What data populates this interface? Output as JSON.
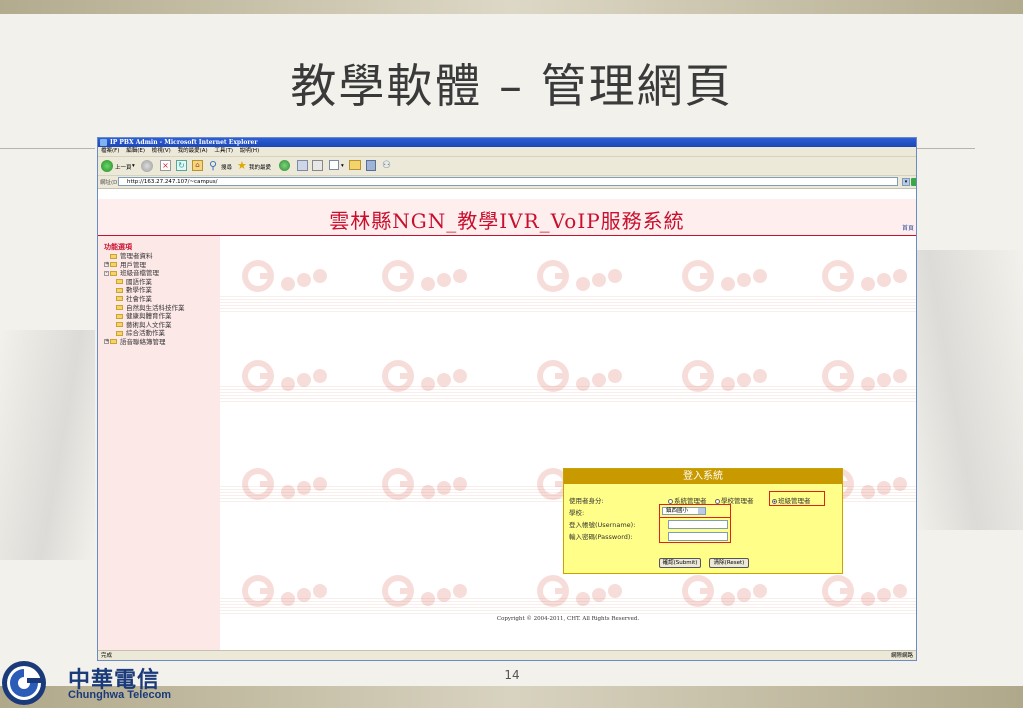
{
  "slide": {
    "title": "教學軟體 – 管理網頁",
    "page_number": "14",
    "logo_zh": "中華電信",
    "logo_en": "Chunghwa Telecom"
  },
  "browser": {
    "title": "IP PBX Admin - Microsoft Internet Explorer",
    "menu": [
      "檔案(F)",
      "編輯(E)",
      "檢視(V)",
      "我的最愛(A)",
      "工具(T)",
      "說明(H)"
    ],
    "toolbar": {
      "back": "上一頁",
      "search": "搜尋",
      "favorites": "我的最愛"
    },
    "address_label": "網址(D)",
    "address": "http://163.27.247.107/~campus/",
    "status_left": "完成",
    "status_right": "網際網路"
  },
  "page": {
    "system_title": "雲林縣NGN_教學IVR_VoIP服務系統",
    "home_link": "首頁",
    "sidebar": {
      "heading": "功能選項",
      "items": [
        {
          "label": "管理者資料",
          "level": 1,
          "expander": ""
        },
        {
          "label": "用戶管理",
          "level": 0,
          "expander": "+"
        },
        {
          "label": "班級音檔管理",
          "level": 0,
          "expander": "-"
        },
        {
          "label": "國語作業",
          "level": 2,
          "expander": ""
        },
        {
          "label": "數學作業",
          "level": 2,
          "expander": ""
        },
        {
          "label": "社會作業",
          "level": 2,
          "expander": ""
        },
        {
          "label": "自然與生活科技作業",
          "level": 2,
          "expander": ""
        },
        {
          "label": "健康與體育作業",
          "level": 2,
          "expander": ""
        },
        {
          "label": "藝術與人文作業",
          "level": 2,
          "expander": ""
        },
        {
          "label": "綜合活動作業",
          "level": 2,
          "expander": ""
        },
        {
          "label": "語音聯絡簿管理",
          "level": 0,
          "expander": "+"
        }
      ]
    },
    "login": {
      "heading": "登入系統",
      "identity_label": "使用者身分:",
      "identity_options": [
        "系統管理者",
        "學校管理者",
        "班級管理者"
      ],
      "identity_selected": "班級管理者",
      "school_label": "學校:",
      "school_value": "鎮西國小",
      "username_label": "登入帳號(Username):",
      "password_label": "輸入密碼(Password):",
      "submit_label": "確認(Submit)",
      "reset_label": "清除(Reset)"
    },
    "copyright": "Copyright © 2004-2011, CHT. All Rights Reserved."
  },
  "colors": {
    "accent_red": "#c8102e",
    "login_bg": "#fffe88",
    "login_header": "#c89a00",
    "titlebar_blue": "#2d5fd6"
  }
}
